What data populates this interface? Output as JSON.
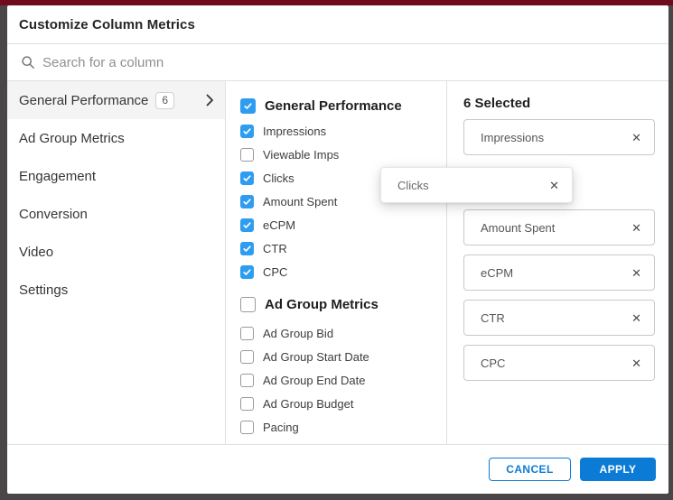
{
  "modal": {
    "title": "Customize Column Metrics",
    "search": {
      "placeholder": "Search for a column",
      "icon": "search-icon"
    },
    "sidebar": {
      "items": [
        {
          "label": "General Performance",
          "badge": "6",
          "selected": true,
          "has_chevron": true
        },
        {
          "label": "Ad Group Metrics",
          "selected": false
        },
        {
          "label": "Engagement",
          "selected": false
        },
        {
          "label": "Conversion",
          "selected": false
        },
        {
          "label": "Video",
          "selected": false
        },
        {
          "label": "Settings",
          "selected": false
        }
      ]
    },
    "metrics_panel": {
      "groups": [
        {
          "header": "General Performance",
          "header_checked": true,
          "items": [
            {
              "label": "Impressions",
              "checked": true
            },
            {
              "label": "Viewable Imps",
              "checked": false
            },
            {
              "label": "Clicks",
              "checked": true
            },
            {
              "label": "Amount Spent",
              "checked": true
            },
            {
              "label": "eCPM",
              "checked": true
            },
            {
              "label": "CTR",
              "checked": true
            },
            {
              "label": "CPC",
              "checked": true
            }
          ]
        },
        {
          "header": "Ad Group Metrics",
          "header_checked": false,
          "items": [
            {
              "label": "Ad Group Bid",
              "checked": false
            },
            {
              "label": "Ad Group Start Date",
              "checked": false
            },
            {
              "label": "Ad Group End Date",
              "checked": false
            },
            {
              "label": "Ad Group Budget",
              "checked": false
            },
            {
              "label": "Pacing",
              "checked": false
            }
          ]
        }
      ]
    },
    "selected_panel": {
      "title": "6 Selected",
      "chips": [
        "Impressions",
        "Amount Spent",
        "eCPM",
        "CTR",
        "CPC"
      ],
      "dragging_chip": "Clicks",
      "remove_icon_glyph": "✕"
    },
    "footer": {
      "cancel_label": "CANCEL",
      "apply_label": "APPLY"
    }
  },
  "colors": {
    "accent_blue": "#0c7bd5",
    "checkbox_blue": "#2e9cf1",
    "top_bar_maroon": "#6f0b1d",
    "backdrop_gray": "#4a4647"
  }
}
